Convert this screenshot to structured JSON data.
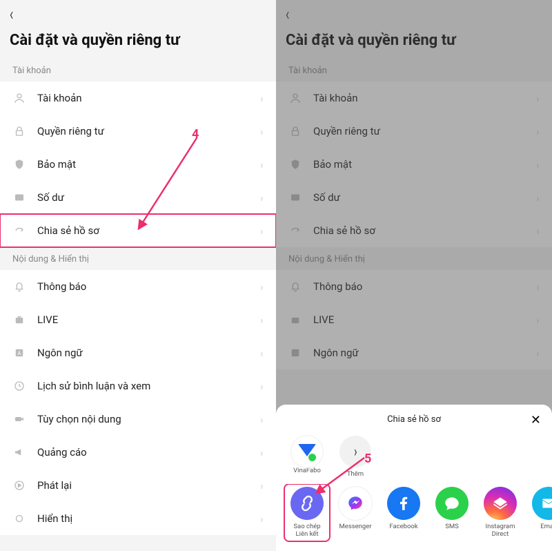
{
  "title": "Cài đặt và quyền riêng tư",
  "section_account": "Tài khoản",
  "section_content": "Nội dung & Hiển thị",
  "rows": {
    "account": "Tài khoản",
    "privacy": "Quyền riêng tư",
    "security": "Bảo mật",
    "balance": "Số dư",
    "share_profile": "Chia sẻ hồ sơ",
    "notifications": "Thông báo",
    "live": "LIVE",
    "language": "Ngôn ngữ",
    "history": "Lịch sử bình luận và xem",
    "content_pref": "Tùy chọn nội dung",
    "ads": "Quảng cáo",
    "playback": "Phát lại",
    "display": "Hiển thị"
  },
  "annotations": {
    "step4": "4",
    "step5": "5"
  },
  "sheet": {
    "title": "Chia sẻ hồ sơ",
    "top_row": {
      "vinafabo": "VinaFabo",
      "more": "Thêm"
    },
    "share_row": {
      "copy": "Sao chép\nLiên kết",
      "messenger": "Messenger",
      "facebook": "Facebook",
      "sms": "SMS",
      "instagram": "Instagram\nDirect",
      "email": "Email"
    }
  }
}
